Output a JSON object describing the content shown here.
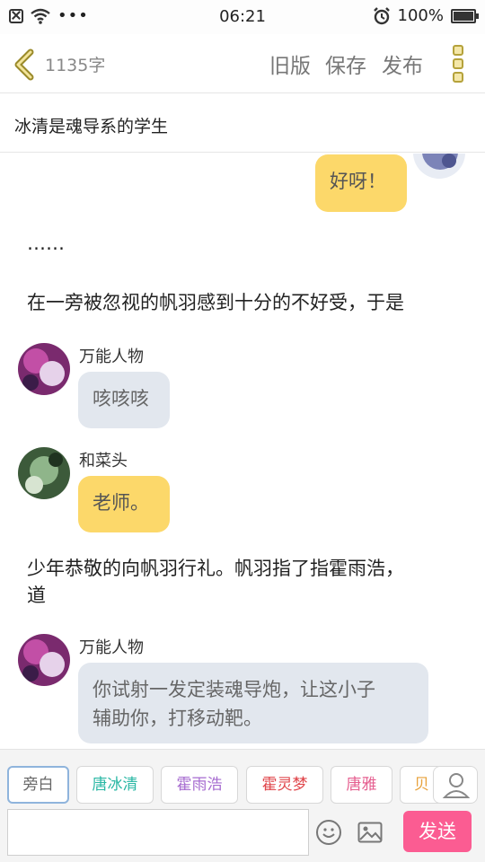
{
  "status": {
    "time": "06:21",
    "battery": "100%"
  },
  "header": {
    "word_count": "1135字",
    "old_version": "旧版",
    "save": "保存",
    "publish": "发布"
  },
  "title": "冰清是魂导系的学生",
  "chat": {
    "msg1": "好呀！",
    "narr1": "……",
    "narr2": "在一旁被忽视的帆羽感到十分的不好受，于是",
    "name2": "万能人物",
    "msg2": "咳咳咳",
    "name3": "和菜头",
    "msg3": "老师。",
    "narr3a": "少年恭敬的向帆羽行礼。帆羽指了指霍雨浩，",
    "narr3b": "道",
    "name4": "万能人物",
    "msg4a": "你试射一发定装魂导炮，让这小子",
    "msg4b": "辅助你，打移动靶。"
  },
  "characters": [
    {
      "label": "旁白",
      "color": "#666666"
    },
    {
      "label": "唐冰清",
      "color": "#2ab7a4"
    },
    {
      "label": "霍雨浩",
      "color": "#a66bd0"
    },
    {
      "label": "霍灵梦",
      "color": "#e0474c"
    },
    {
      "label": "唐雅",
      "color": "#e55e8f"
    },
    {
      "label": "贝",
      "color": "#e8a23c"
    }
  ],
  "input": {
    "placeholder": ""
  },
  "send_label": "发送",
  "colors": {
    "accent": "#fb5c92",
    "yellow_bubble": "#fcd86a",
    "gray_bubble": "#e2e7ee"
  }
}
